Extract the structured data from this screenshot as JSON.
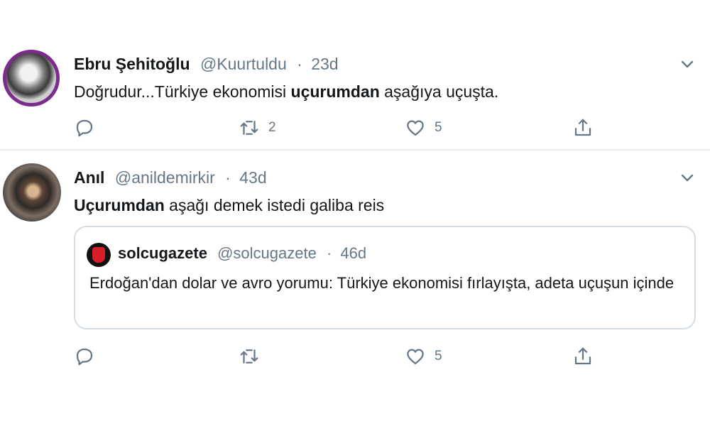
{
  "tweets": [
    {
      "name": "Ebru Şehitoğlu",
      "handle": "@Kuurtuldu",
      "separator": "·",
      "time": "23d",
      "text_before": "Doğrudur...Türkiye ekonomisi ",
      "text_bold": "uçurumdan",
      "text_after": " aşağıya uçuşta.",
      "replies": "",
      "retweets": "2",
      "likes": "5"
    },
    {
      "name": "Anıl",
      "handle": "@anildemirkir",
      "separator": "·",
      "time": "43d",
      "text_bold": "Uçurumdan",
      "text_after": " aşağı demek istedi galiba reis",
      "quote": {
        "name": "solcugazete",
        "handle": "@solcugazete",
        "separator": "·",
        "time": "46d",
        "text": "Erdoğan'dan dolar ve avro yorumu: Türkiye ekonomisi fırlayışta, adeta uçuşun içinde"
      },
      "replies": "",
      "retweets": "",
      "likes": "5"
    }
  ],
  "icons": {
    "reply": "reply-icon",
    "retweet": "retweet-icon",
    "like": "like-icon",
    "share": "share-icon",
    "more": "chevron-down-icon"
  },
  "colors": {
    "text": "#14171a",
    "secondary": "#657786",
    "border": "#d5dde3",
    "divider": "#e6ecf0"
  }
}
